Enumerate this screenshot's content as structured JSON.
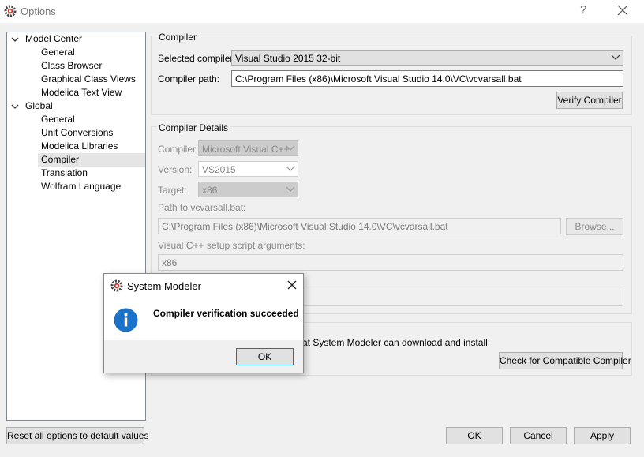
{
  "window": {
    "title": "Options",
    "help_glyph": "?",
    "title_icon": "gear-icon",
    "close_icon": "close-icon"
  },
  "tree": [
    {
      "label": "Model Center",
      "level": 0,
      "expanded": true
    },
    {
      "label": "General",
      "level": 1
    },
    {
      "label": "Class Browser",
      "level": 1
    },
    {
      "label": "Graphical Class Views",
      "level": 1
    },
    {
      "label": "Modelica Text View",
      "level": 1
    },
    {
      "label": "Global",
      "level": 0,
      "expanded": true
    },
    {
      "label": "General",
      "level": 1
    },
    {
      "label": "Unit Conversions",
      "level": 1
    },
    {
      "label": "Modelica Libraries",
      "level": 1
    },
    {
      "label": "Compiler",
      "level": 1,
      "selected": true
    },
    {
      "label": "Translation",
      "level": 1
    },
    {
      "label": "Wolfram Language",
      "level": 1
    }
  ],
  "compiler": {
    "group_title": "Compiler",
    "selected_label": "Selected compiler:",
    "selected_value": "Visual Studio 2015 32-bit",
    "path_label": "Compiler path:",
    "path_value": "C:\\Program Files (x86)\\Microsoft Visual Studio 14.0\\VC\\vcvarsall.bat",
    "verify_button": "Verify Compiler"
  },
  "details": {
    "group_title": "Compiler Details",
    "compiler_label": "Compiler:",
    "compiler_value": "Microsoft Visual C++",
    "version_label": "Version:",
    "version_value": "VS2015",
    "target_label": "Target:",
    "target_value": "x86",
    "vcvars_label": "Path to vcvarsall.bat:",
    "vcvars_value": "C:\\Program Files (x86)\\Microsoft Visual Studio 14.0\\VC\\vcvarsall.bat",
    "browse_button": "Browse...",
    "args_label": "Visual C++ setup script arguments:",
    "args_value": "x86"
  },
  "compat": {
    "partial_text": "at System Modeler can download and install.",
    "check_button": "Check for Compatible Compiler"
  },
  "footer": {
    "reset_button": "Reset all options to default values",
    "ok_button": "OK",
    "cancel_button": "Cancel",
    "apply_button": "Apply"
  },
  "dialog": {
    "title": "System Modeler",
    "message": "Compiler verification succeeded",
    "ok_button": "OK",
    "info_icon": "info-icon",
    "info_color": "#1a73c8"
  },
  "colors": {
    "accent": "#0078d7",
    "selection": "#e5e5e5"
  }
}
